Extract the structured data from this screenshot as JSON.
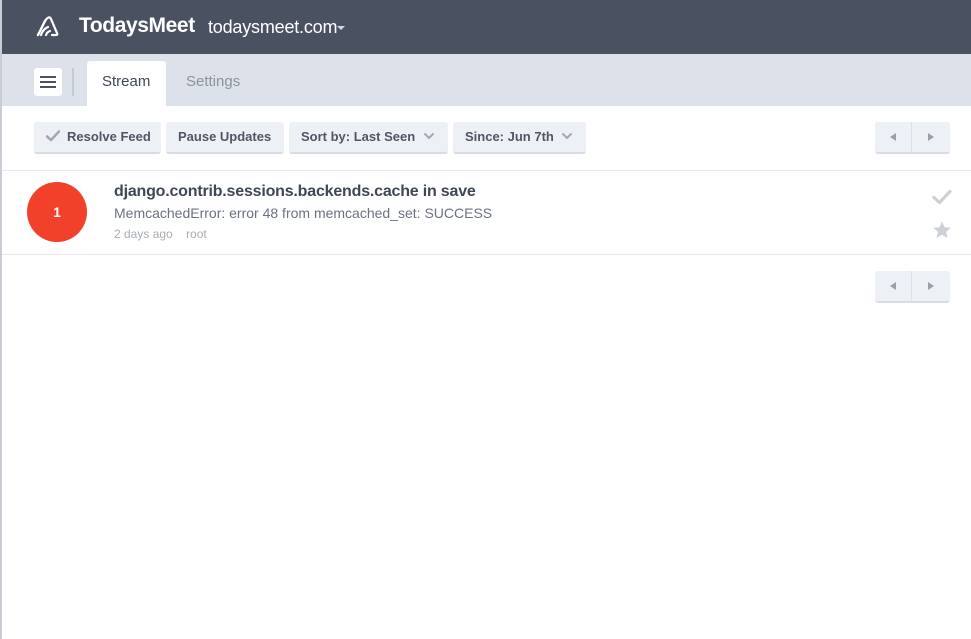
{
  "header": {
    "brand": "TodaysMeet",
    "team": "todaysmeet.com"
  },
  "tabs": [
    {
      "label": "Stream",
      "active": true
    },
    {
      "label": "Settings",
      "active": false
    }
  ],
  "toolbar": {
    "resolve_label": "Resolve Feed",
    "pause_label": "Pause Updates",
    "sort_label": "Sort by: Last Seen",
    "since_label": "Since: Jun 7th"
  },
  "events": [
    {
      "count": "1",
      "title": "django.contrib.sessions.backends.cache in save",
      "message": "MemcachedError: error 48 from memcached_set: SUCCESS",
      "time": "2 days ago",
      "logger": "root"
    }
  ],
  "icons": {
    "logo": "sentry-logo-icon",
    "menu": "hamburger-menu-icon",
    "resolve": "check-icon",
    "bookmark": "star-icon",
    "prev": "arrow-left-icon",
    "next": "arrow-right-icon",
    "dropdown": "chevron-down-icon"
  },
  "colors": {
    "header_bg": "#4a5262",
    "tabbar_bg": "#dde2ea",
    "count_badge": "#f1412b",
    "button_bg": "#edf0f4"
  }
}
